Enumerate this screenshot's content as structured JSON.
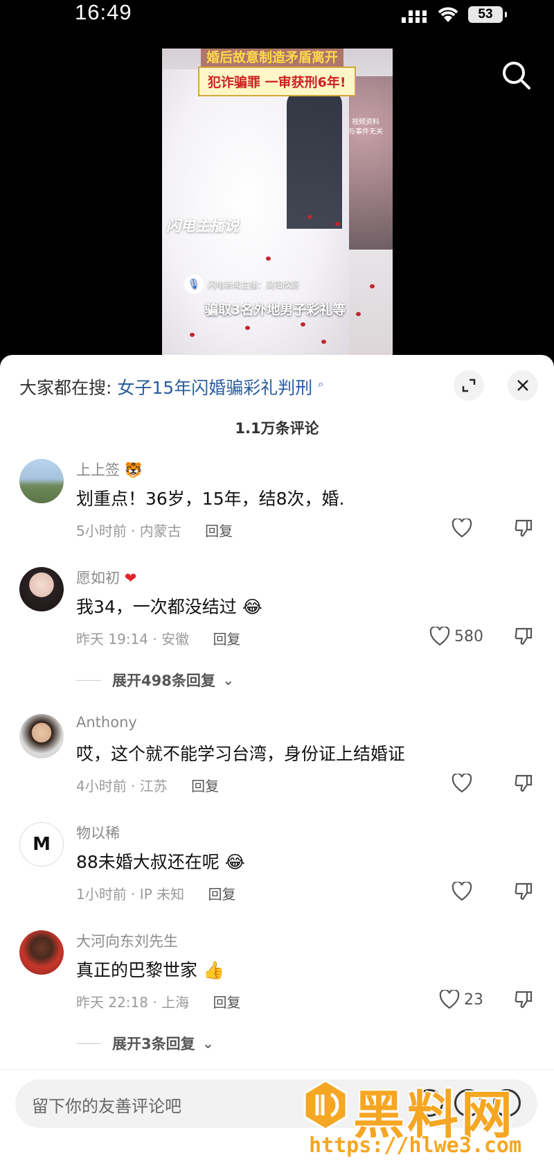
{
  "status_bar": {
    "time": "16:49",
    "battery": "53"
  },
  "video": {
    "headline_top": "婚后故意制造矛盾离开",
    "headline": "犯诈骗罪 一审获刑6年!",
    "side_note_1": "视频资料",
    "side_note_2": "与事件无关",
    "logo": "闪电主播说",
    "reporter": "闪电新闻主播：吴阳欣蔚",
    "subtitle": "骗取3名外地男子彩礼等"
  },
  "panel": {
    "hot_search_prefix": "大家都在搜:",
    "hot_search_keyword": "女子15年闪婚骗彩礼判刑",
    "comment_count": "1.1万条评论"
  },
  "comments": [
    {
      "name": "上上签",
      "text": "划重点！36岁，15年，结8次，婚.",
      "time": "5小时前 · 内蒙古",
      "reply": "回复",
      "likes": ""
    },
    {
      "name": "愿如初",
      "text": "我34，一次都没结过",
      "time": "昨天 19:14 · 安徽",
      "reply": "回复",
      "likes": "580",
      "expand": "展开498条回复"
    },
    {
      "name": "Anthony",
      "text": "哎，这个就不能学习台湾，身份证上结婚证",
      "time": "4小时前 · 江苏",
      "reply": "回复",
      "likes": ""
    },
    {
      "name": "物以稀",
      "text": "88未婚大叔还在呢",
      "time": "1小时前 · IP 未知",
      "reply": "回复",
      "likes": ""
    },
    {
      "name": "大河向东刘先生",
      "text": "真正的巴黎世家",
      "time": "昨天 22:18 · 上海",
      "reply": "回复",
      "likes": "23",
      "expand": "展开3条回复"
    }
  ],
  "input": {
    "placeholder": "留下你的友善评论吧"
  },
  "watermark": {
    "text": "黑料网",
    "url": "https://hlwe3.com"
  },
  "colors": {
    "keyword": "#2a5d9f",
    "watermark": "#f5a623",
    "headline_red": "#cc2222"
  }
}
